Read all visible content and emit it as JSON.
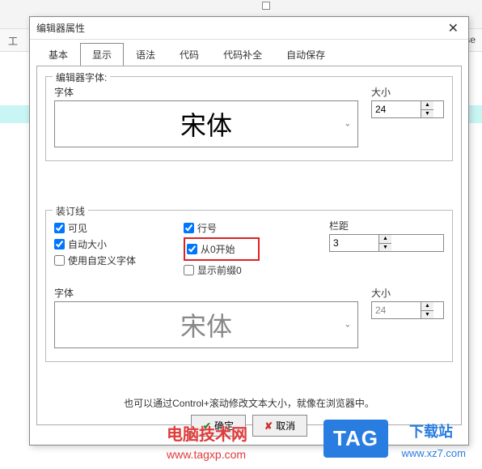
{
  "background": {
    "toolbar_hint": "工",
    "release_text": "c Release"
  },
  "dialog": {
    "title": "编辑器属性",
    "tabs": [
      "基本",
      "显示",
      "语法",
      "代码",
      "代码补全",
      "自动保存"
    ],
    "active_tab_index": 1
  },
  "editor_font": {
    "legend": "编辑器字体:",
    "font_label": "字体",
    "font_value": "宋体",
    "size_label": "大小",
    "size_value": "24"
  },
  "gutter": {
    "legend": "装订线",
    "visible_label": "可见",
    "visible_checked": true,
    "auto_size_label": "自动大小",
    "auto_size_checked": true,
    "custom_font_label": "使用自定义字体",
    "custom_font_checked": false,
    "line_number_label": "行号",
    "line_number_checked": true,
    "start_zero_label": "从0开始",
    "start_zero_checked": true,
    "leading_zero_label": "显示前缀0",
    "leading_zero_checked": false,
    "spacing_label": "栏距",
    "spacing_value": "3",
    "font_label": "字体",
    "font_value": "宋体",
    "size_label": "大小",
    "size_value": "24"
  },
  "hint": "也可以通过Control+滚动修改文本大小，就像在浏览器中。",
  "buttons": {
    "ok": "确定",
    "cancel": "取消"
  },
  "watermarks": {
    "w1_title": "电脑技术网",
    "w1_url": "www.tagxp.com",
    "tag": "TAG",
    "xz_title": "下载站",
    "xz_url": "www.xz7.com"
  }
}
